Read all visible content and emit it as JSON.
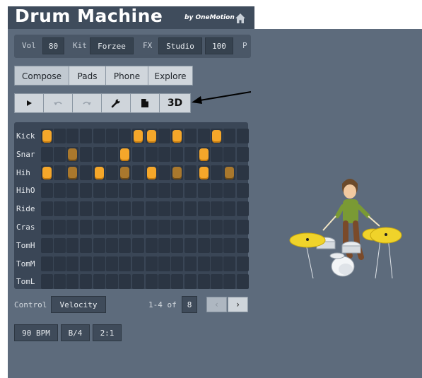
{
  "app": {
    "title": "Drum Machine",
    "byline": "by OneMotion"
  },
  "params": {
    "vol_label": "Vol",
    "vol_value": "80",
    "kit_label": "Kit",
    "kit_value": "Forzee",
    "fx_label": "FX",
    "fx_value": "Studio",
    "fx_amount": "100",
    "p_label": "P"
  },
  "tabs": [
    "Compose",
    "Pads",
    "Phone",
    "Explore"
  ],
  "active_tab": "Compose",
  "toolbar": {
    "play_icon": "play-icon",
    "undo_icon": "undo-icon",
    "redo_icon": "redo-icon",
    "tools_icon": "wrench-icon",
    "file_icon": "document-icon",
    "view_3d_label": "3D"
  },
  "tracks": [
    {
      "name": "Kick",
      "on": [
        0,
        7,
        8,
        10,
        13
      ],
      "dim": []
    },
    {
      "name": "Snar",
      "on": [
        6,
        12
      ],
      "dim": [
        2
      ]
    },
    {
      "name": "Hih",
      "on": [
        0,
        4,
        8,
        12
      ],
      "dim": [
        2,
        6,
        10,
        14
      ]
    },
    {
      "name": "HihO",
      "on": [],
      "dim": []
    },
    {
      "name": "Ride",
      "on": [],
      "dim": []
    },
    {
      "name": "Cras",
      "on": [],
      "dim": []
    },
    {
      "name": "TomH",
      "on": [],
      "dim": []
    },
    {
      "name": "TomM",
      "on": [],
      "dim": []
    },
    {
      "name": "TomL",
      "on": [],
      "dim": []
    }
  ],
  "steps": 16,
  "control": {
    "label": "Control",
    "value": "Velocity",
    "page_info": "1-4 of",
    "page_total": "8",
    "prev_label": "‹",
    "next_label": "›"
  },
  "tempo": {
    "bpm": "90 BPM",
    "meter": "B/4",
    "swing": "2:1"
  },
  "colors": {
    "pad_on": "#f5a72a",
    "pad_dim": "#a9782d",
    "background": "#5d6b7c"
  }
}
